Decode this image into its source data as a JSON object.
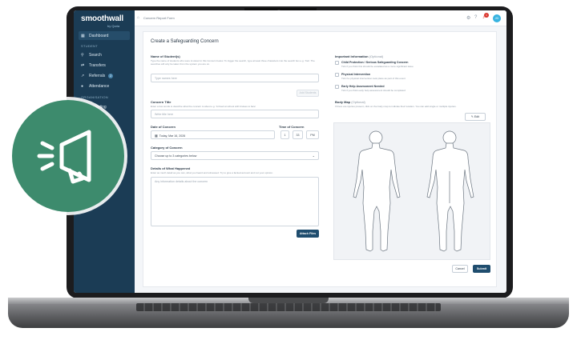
{
  "sidebar": {
    "logo": "smoothwall",
    "logo_sub": "by Qoria",
    "sections": [
      "STUDENT",
      "ORGANISATION"
    ],
    "items": [
      {
        "label": "Dashboard",
        "icon": "grid-icon"
      },
      {
        "label": "Search",
        "icon": "search-icon"
      },
      {
        "label": "Transfers",
        "icon": "transfer-icon"
      },
      {
        "label": "Referrals",
        "icon": "referral-icon",
        "badge": "2"
      },
      {
        "label": "Attendance",
        "icon": "attendance-icon"
      },
      {
        "label": "Reporting",
        "icon": "chart-icon"
      }
    ]
  },
  "topbar": {
    "breadcrumb": "Concern Report Form",
    "notifications": "1",
    "avatar": "JD"
  },
  "form": {
    "title": "Create a Safeguarding Concern",
    "students_label": "Name of Student(s)",
    "students_hint": "Type the name of students who were involved in this Concern below. To trigger the search, type at least three characters into the search box e.g. 'Kat'. The searches will only be taken from the system you are on.",
    "students_placeholder": "Type names here",
    "add_students_button": "Add Students",
    "concern_title_label": "Concern Title",
    "concern_title_hint": "Enter a few words to describe what the concern is about e.g. 'Arrived at school with bruises to face'",
    "concern_title_placeholder": "Write title here",
    "date_label": "Date of Concern",
    "date_value": "Today, Mar 16, 2026",
    "time_label": "Time of Concern",
    "time_hour": "1",
    "time_minute": "33",
    "time_period": "PM",
    "category_label": "Category of Concern",
    "category_placeholder": "Choose up to 3 categories below",
    "details_label": "Details of What Happened",
    "details_hint": "Enter as much detail as you can, what you heard and witnessed. Try to give a factual account and not your opinion.",
    "details_placeholder": "Any information details about the concern",
    "attach_button": "Attach Files",
    "important_label": "Important Information",
    "important_optional": "(Optional)",
    "checks": [
      {
        "label": "Child Protection / Serious Safeguarding Concern",
        "hint": "Tick if you think this should be escalated as a more significant issue"
      },
      {
        "label": "Physical Intervention",
        "hint": "Tick if a physical intervention took place as part of this event"
      },
      {
        "label": "Early Help Assessment Needed",
        "hint": "Tick if you think early help assessment should be completed"
      }
    ],
    "body_map_label": "Body Map",
    "body_map_optional": "(Optional)",
    "body_map_hint": "If there are injuries present, click on the body map to indicate their location. You can add single or multiple injuries.",
    "edit_button": "Edit",
    "cancel_button": "Cancel",
    "submit_button": "Submit"
  },
  "colors": {
    "sidebar": "#1b3c55",
    "primary": "#1f4d6e",
    "badge_green": "#3d8b6d",
    "accent": "#37b3e0",
    "alert": "#d9342b"
  }
}
